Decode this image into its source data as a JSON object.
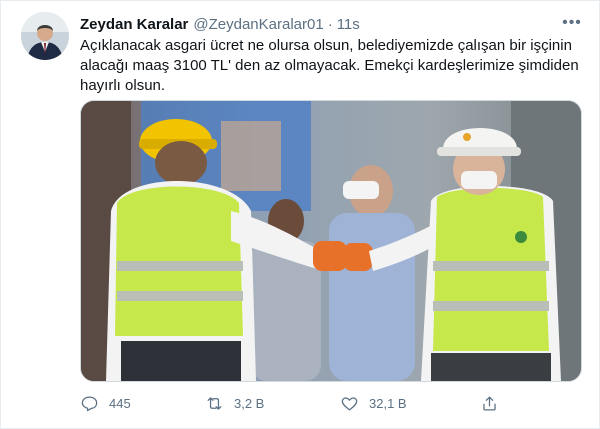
{
  "tweet": {
    "display_name": "Zeydan Karalar",
    "handle": "@ZeydanKaralar01",
    "separator": "·",
    "time": "11s",
    "more_glyph": "•••",
    "text_lines": [
      "Açıklanacak asgari ücret ne olursa olsun, belediyemizde çalışan bir işçinin",
      "alacağı maaş 3100 TL' den az olmayacak. Emekçi kardeşlerimize şimdiden",
      "hayırlı olsun."
    ]
  },
  "actions": {
    "reply_count": "445",
    "retweet_count": "3,2 B",
    "like_count": "32,1 B"
  },
  "icons": {
    "reply": "reply-icon",
    "retweet": "retweet-icon",
    "like": "heart-icon",
    "share": "share-icon",
    "more": "more-icon"
  },
  "colors": {
    "text": "#0f1419",
    "secondary": "#5b7083",
    "border": "#cfd9de",
    "safety_vest": "#c6e84a",
    "helmet_yellow": "#f2c300",
    "helmet_white": "#f4f4f2",
    "glove_orange": "#e8712a"
  }
}
